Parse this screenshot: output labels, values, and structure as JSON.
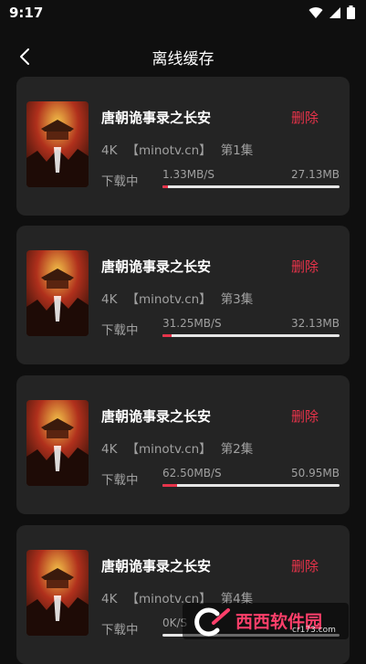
{
  "status_bar": {
    "time": "9:17",
    "icons": [
      "wifi-icon",
      "signal-icon",
      "battery-icon"
    ]
  },
  "header": {
    "back_icon": "chevron-left-icon",
    "title": "离线缓存"
  },
  "colors": {
    "background": "#0f0f0f",
    "card": "#242424",
    "accent": "#e8334a",
    "secondary_text": "#a0a0a0"
  },
  "items": [
    {
      "title": "唐朝诡事录之长安",
      "delete_label": "删除",
      "quality": "4K",
      "source": "【minotv.cn】",
      "episode": "第1集",
      "status": "下载中",
      "speed": "1.33MB/S",
      "size": "27.13MB",
      "progress": 0.03
    },
    {
      "title": "唐朝诡事录之长安",
      "delete_label": "删除",
      "quality": "4K",
      "source": "【minotv.cn】",
      "episode": "第3集",
      "status": "下载中",
      "speed": "31.25MB/S",
      "size": "32.13MB",
      "progress": 0.05
    },
    {
      "title": "唐朝诡事录之长安",
      "delete_label": "删除",
      "quality": "4K",
      "source": "【minotv.cn】",
      "episode": "第2集",
      "status": "下载中",
      "speed": "62.50MB/S",
      "size": "50.95MB",
      "progress": 0.08
    },
    {
      "title": "唐朝诡事录之长安",
      "delete_label": "删除",
      "quality": "4K",
      "source": "【minotv.cn】",
      "episode": "第4集",
      "status": "下载中",
      "speed": "0K/S",
      "size": "",
      "progress": 0.0
    }
  ],
  "watermark": {
    "text": "西西软件园",
    "sub": "cr173.com"
  }
}
